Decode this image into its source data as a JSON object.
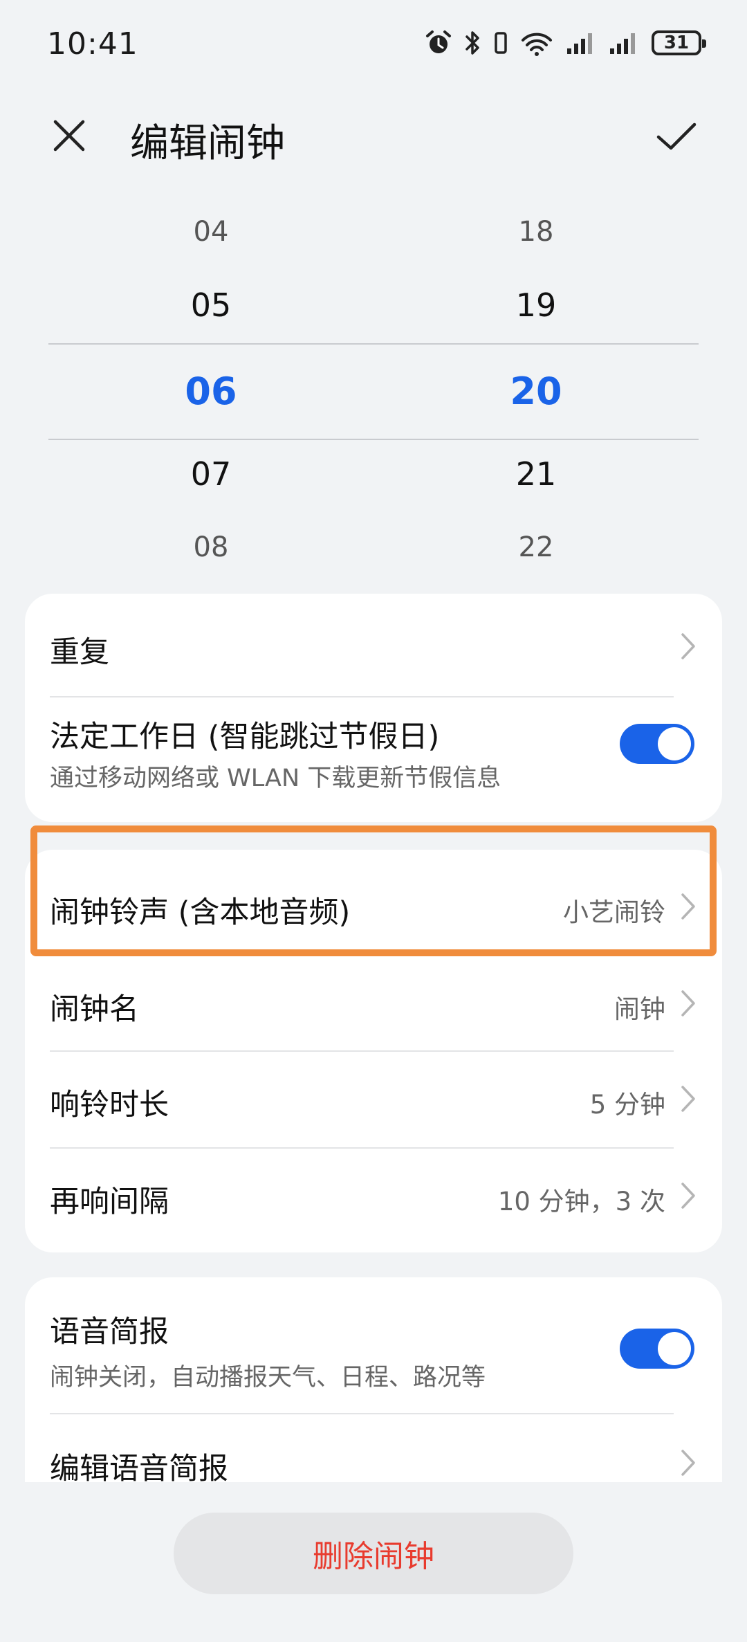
{
  "status_bar": {
    "time": "10:41",
    "battery_level": "31",
    "icons": [
      "alarm-icon",
      "bluetooth-icon",
      "vibrate-icon",
      "wifi-icon",
      "signal-icon",
      "signal-icon",
      "battery-icon"
    ]
  },
  "header": {
    "title": "编辑闹钟",
    "close_icon": "close-icon",
    "confirm_icon": "check-icon"
  },
  "time_picker": {
    "hours": [
      "04",
      "05",
      "06",
      "07",
      "08"
    ],
    "minutes": [
      "18",
      "19",
      "20",
      "21",
      "22"
    ],
    "selected_hour": "06",
    "selected_minute": "20",
    "selected_color": "#1a63e8"
  },
  "settings_card_1": {
    "repeat": {
      "title": "重复"
    },
    "workday": {
      "title": "法定工作日 (智能跳过节假日)",
      "subtitle": "通过移动网络或 WLAN 下载更新节假信息",
      "toggle_on": true
    }
  },
  "settings_card_2": {
    "ringtone": {
      "title": "闹钟铃声 (含本地音频)",
      "value": "小艺闹铃"
    },
    "name": {
      "title": "闹钟名",
      "value": "闹钟"
    },
    "duration": {
      "title": "响铃时长",
      "value": "5 分钟"
    },
    "snooze": {
      "title": "再响间隔",
      "value": "10 分钟，3 次"
    }
  },
  "settings_card_3": {
    "voice_brief": {
      "title": "语音简报",
      "subtitle": "闹钟关闭，自动播报天气、日程、路况等",
      "toggle_on": true
    },
    "edit_voice_brief": {
      "title": "编辑语音简报"
    }
  },
  "delete_button": {
    "label": "删除闹钟",
    "color": "#e83b2e"
  },
  "highlight_color": "#f08c3c",
  "accent_color": "#1a63e8"
}
